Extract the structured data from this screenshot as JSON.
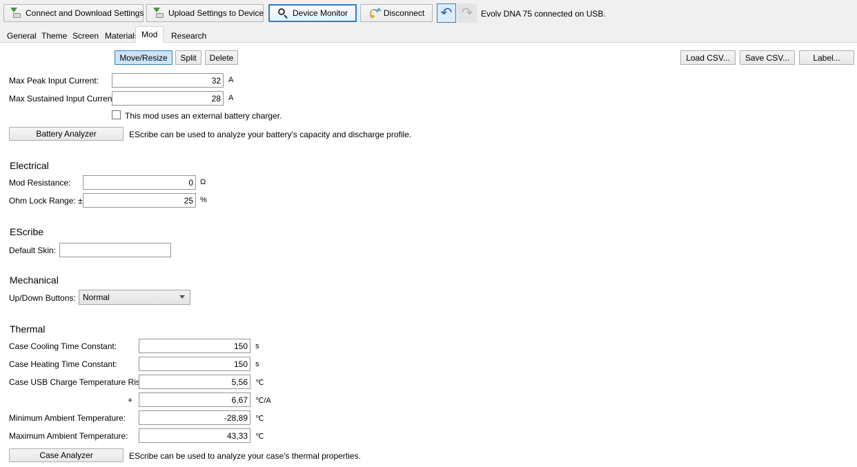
{
  "toolbar": {
    "connect_label": "Connect and Download Settings",
    "upload_label": "Upload Settings to Device",
    "monitor_label": "Device Monitor",
    "disconnect_label": "Disconnect",
    "undo_glyph": "↶",
    "redo_glyph": "↷",
    "status": "Evolv DNA 75 connected on USB.",
    "accent_color": "#2e7cc4"
  },
  "tabs": [
    {
      "label": "General",
      "active": false
    },
    {
      "label": "Theme",
      "active": false
    },
    {
      "label": "Screen",
      "active": false
    },
    {
      "label": "Materials",
      "active": false
    },
    {
      "label": "Mod",
      "active": true
    },
    {
      "label": "Research",
      "active": false
    }
  ],
  "actions": {
    "move_resize": "Move/Resize",
    "split": "Split",
    "delete": "Delete",
    "load_csv": "Load CSV...",
    "save_csv": "Save CSV...",
    "label": "Label..."
  },
  "battery": {
    "max_peak_label": "Max Peak Input Current:",
    "max_peak_value": "32",
    "max_peak_unit": "A",
    "max_sustained_label": "Max Sustained Input Current:",
    "max_sustained_value": "28",
    "max_sustained_unit": "A",
    "external_charger_label": "This mod uses an external battery charger.",
    "external_charger_checked": false,
    "analyzer_button": "Battery Analyzer",
    "analyzer_desc": "EScribe can be used to analyze your battery's capacity and discharge profile."
  },
  "electrical": {
    "heading": "Electrical",
    "mod_resistance_label": "Mod Resistance:",
    "mod_resistance_value": "0",
    "mod_resistance_unit": "Ω",
    "ohm_lock_label": "Ohm Lock Range: ±",
    "ohm_lock_value": "25",
    "ohm_lock_unit": "%"
  },
  "escribe": {
    "heading": "EScribe",
    "default_skin_label": "Default Skin:",
    "default_skin_value": ""
  },
  "mechanical": {
    "heading": "Mechanical",
    "updown_label": "Up/Down Buttons:",
    "updown_value": "Normal",
    "updown_options": [
      "Normal"
    ]
  },
  "thermal": {
    "heading": "Thermal",
    "rows": [
      {
        "label": "Case Cooling Time Constant:",
        "value": "150",
        "unit": "s"
      },
      {
        "label": "Case Heating Time Constant:",
        "value": "150",
        "unit": "s"
      },
      {
        "label": "Case USB Charge Temperature Rise:",
        "value": "5,56",
        "unit": "℃"
      },
      {
        "label": "+",
        "value": "6,67",
        "unit": "℃/A"
      },
      {
        "label": "Minimum Ambient Temperature:",
        "value": "-28,89",
        "unit": "℃"
      },
      {
        "label": "Maximum Ambient Temperature:",
        "value": "43,33",
        "unit": "℃"
      }
    ],
    "analyzer_button": "Case Analyzer",
    "analyzer_desc": "EScribe can be used to analyze your case's thermal properties."
  }
}
